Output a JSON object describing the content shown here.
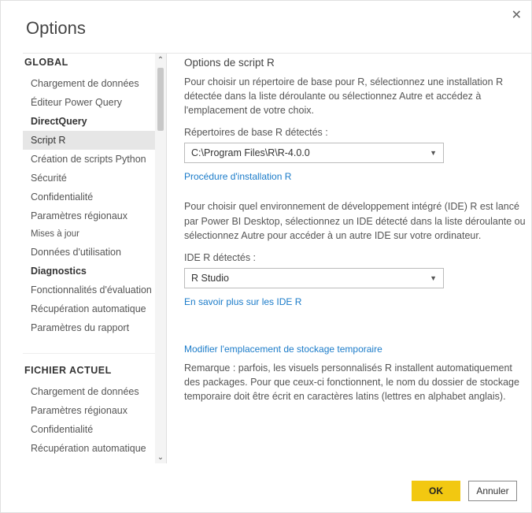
{
  "window": {
    "title": "Options"
  },
  "sidebar": {
    "global_header": "GLOBAL",
    "file_header": "FICHIER ACTUEL",
    "global_items": [
      {
        "label": "Chargement de données"
      },
      {
        "label": "Éditeur Power Query"
      },
      {
        "label": "DirectQuery",
        "bold": true
      },
      {
        "label": "Script R",
        "selected": true
      },
      {
        "label": "Création de scripts Python"
      },
      {
        "label": "Sécurité"
      },
      {
        "label": "Confidentialité"
      },
      {
        "label": "Paramètres régionaux"
      },
      {
        "label": "Mises à jour",
        "small": true
      },
      {
        "label": "Données d'utilisation"
      },
      {
        "label": "Diagnostics",
        "bold": true
      },
      {
        "label": "Fonctionnalités d'évaluation"
      },
      {
        "label": "Récupération automatique"
      },
      {
        "label": "Paramètres du rapport"
      }
    ],
    "file_items": [
      {
        "label": "Chargement de données"
      },
      {
        "label": "Paramètres régionaux"
      },
      {
        "label": "Confidentialité"
      },
      {
        "label": "Récupération automatique"
      }
    ]
  },
  "main": {
    "section_title": "Options de script R",
    "intro": "Pour choisir un répertoire de base pour R, sélectionnez une installation R détectée dans la liste déroulante ou sélectionnez Autre et accédez à l'emplacement de votre choix.",
    "base_dir_label": "Répertoires de base R détectés :",
    "base_dir_value": "C:\\Program Files\\R\\R-4.0.0",
    "install_link": "Procédure d'installation R",
    "ide_intro": "Pour choisir quel environnement de développement intégré (IDE) R est lancé par Power BI Desktop, sélectionnez un IDE détecté dans la liste déroulante ou sélectionnez Autre pour accéder à un autre IDE sur votre ordinateur.",
    "ide_label": "IDE R détectés :",
    "ide_value": "R Studio",
    "ide_link": "En savoir plus sur les IDE R",
    "temp_link": "Modifier l'emplacement de stockage temporaire",
    "temp_note": "Remarque : parfois, les visuels personnalisés R installent automatiquement des packages. Pour que ceux-ci fonctionnent, le nom du dossier de stockage temporaire doit être écrit en caractères latins (lettres en alphabet anglais)."
  },
  "footer": {
    "ok": "OK",
    "cancel": "Annuler"
  }
}
